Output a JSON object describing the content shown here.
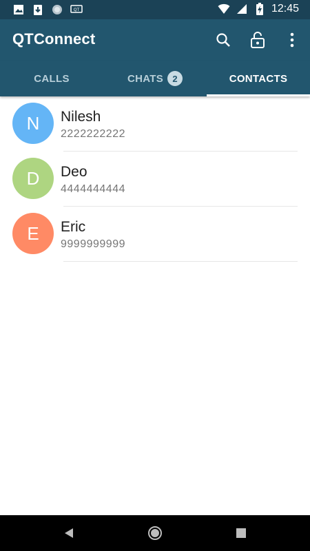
{
  "status_bar": {
    "time": "12:45",
    "notification_icons": [
      "image-icon",
      "download-icon",
      "circle-icon",
      "qt-icon"
    ],
    "system_icons": [
      "wifi-icon",
      "signal-icon",
      "battery-charging-icon"
    ]
  },
  "app_bar": {
    "title": "QTConnect",
    "actions": [
      "search-icon",
      "lock-open-icon",
      "more-vert-icon"
    ]
  },
  "tabs": [
    {
      "label": "CALLS",
      "active": false
    },
    {
      "label": "CHATS",
      "badge": "2",
      "active": false
    },
    {
      "label": "CONTACTS",
      "active": true
    }
  ],
  "contacts": [
    {
      "initial": "N",
      "name": "Nilesh",
      "phone": "2222222222",
      "color": "#64b5f6"
    },
    {
      "initial": "D",
      "name": "Deo",
      "phone": "4444444444",
      "color": "#aed581"
    },
    {
      "initial": "E",
      "name": "Eric",
      "phone": "9999999999",
      "color": "#ff8a65"
    }
  ],
  "theme": {
    "primary": "#22566e",
    "primary_dark": "#1b4256"
  },
  "nav_bar": {
    "buttons": [
      "back-icon",
      "home-icon",
      "recents-icon"
    ]
  }
}
